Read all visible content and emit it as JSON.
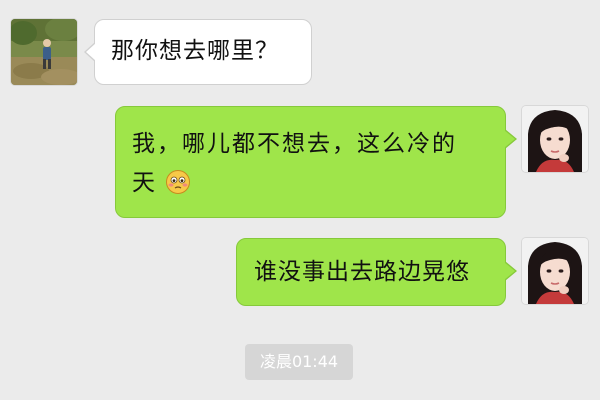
{
  "conversation": {
    "messages": [
      {
        "side": "left",
        "text": "那你想去哪里？",
        "avatar": "landscape-photo-avatar"
      },
      {
        "side": "right",
        "text_line1": "我，哪儿都不想去，这么冷的",
        "text_line2": "天",
        "emoji": "shy-blushing-face",
        "avatar": "girl-portrait-avatar"
      },
      {
        "side": "right",
        "text": "谁没事出去路边晃悠",
        "avatar": "girl-portrait-avatar"
      }
    ],
    "timestamp": "凌晨01:44"
  },
  "colors": {
    "background": "#ebebeb",
    "sent_bubble": "#9fe54a",
    "received_bubble": "#ffffff",
    "timestamp_bg": "#d6d6d6"
  }
}
